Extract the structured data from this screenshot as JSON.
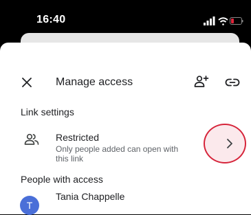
{
  "status_bar": {
    "time": "16:40",
    "icons": [
      "cellular-signal-icon",
      "wifi-icon",
      "battery-low-icon"
    ],
    "battery_color": "#e0243a"
  },
  "toolbar": {
    "title": "Manage access",
    "close_icon": "close-icon",
    "add_person_icon": "person-add-icon",
    "link_icon": "link-icon"
  },
  "link_settings": {
    "section_label": "Link settings",
    "access_label": "Restricted",
    "access_description": "Only people added can open with this link",
    "icon": "people-icon",
    "chevron_icon": "chevron-right-icon",
    "highlight_color": "#d6243a"
  },
  "people_with_access": {
    "section_label": "People with access",
    "people": [
      {
        "name": "Tania Chappelle",
        "initial": "T",
        "avatar_color": "#4a6fd8"
      }
    ]
  }
}
